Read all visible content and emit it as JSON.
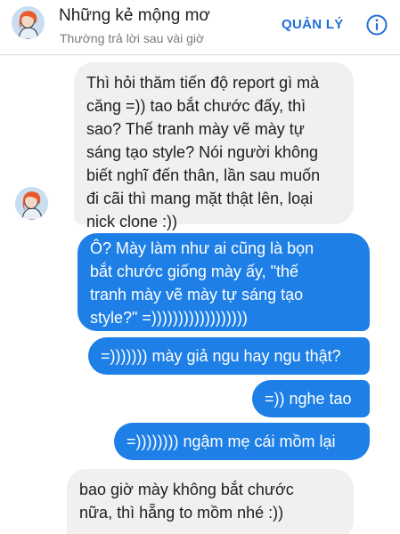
{
  "header": {
    "title": "Những kẻ mộng mơ",
    "subtitle": "Thường trả lời sau vài giờ",
    "manage_label": "QUẢN LÝ",
    "info_icon": "info-icon",
    "accent_color": "#1e6fd9"
  },
  "messages": [
    {
      "direction": "incoming",
      "lines": [
        "Thì hỏi thăm tiến độ report gì mà",
        "căng =)) tao bắt chước đấy, thì",
        "sao? Thế tranh mày vẽ mày tự",
        "sáng tạo style? Nói người không",
        "biết nghĩ đến thân, lần sau muốn",
        "đi cãi thì mang mặt thật lên, loại",
        "nick clone :))"
      ]
    },
    {
      "direction": "outgoing",
      "lines": [
        "Ô? Mày làm như ai cũng là bọn",
        "bắt chước giống mày ấy, \"thế",
        "tranh mày vẽ mày tự sáng tạo",
        "style?\" =))))))))))))))))))"
      ]
    },
    {
      "direction": "outgoing",
      "lines": [
        "=))))))) mày giả ngu hay ngu thật?"
      ]
    },
    {
      "direction": "outgoing",
      "lines": [
        "=)) nghe tao"
      ]
    },
    {
      "direction": "outgoing",
      "lines": [
        "=)))))))) ngậm mẹ cái mồm lại"
      ]
    },
    {
      "direction": "incoming",
      "lines": [
        "bao giờ mày không bắt chước",
        "nữa, thì hẵng to mồm nhé :))"
      ]
    }
  ],
  "colors": {
    "incoming_bubble": "#f0f0f0",
    "outgoing_bubble": "#1e7fe6"
  }
}
